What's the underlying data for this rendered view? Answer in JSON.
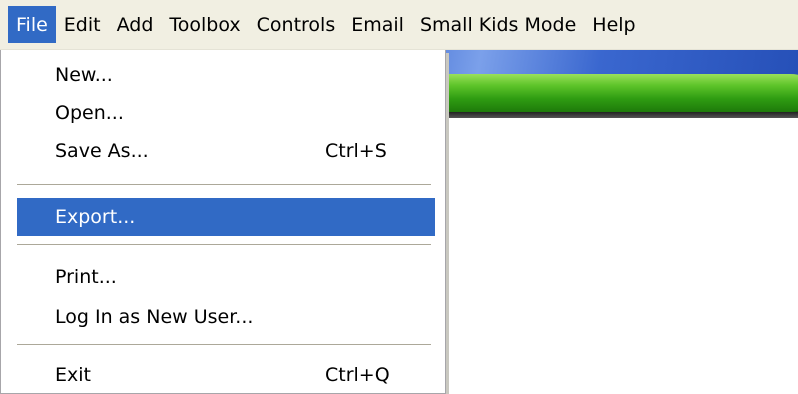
{
  "menubar": {
    "items": [
      {
        "label": "File",
        "active": true
      },
      {
        "label": "Edit"
      },
      {
        "label": "Add"
      },
      {
        "label": "Toolbox"
      },
      {
        "label": "Controls"
      },
      {
        "label": "Email"
      },
      {
        "label": "Small Kids Mode"
      },
      {
        "label": "Help"
      }
    ]
  },
  "file_menu": {
    "items": [
      {
        "label": "New...",
        "shortcut": ""
      },
      {
        "label": "Open...",
        "shortcut": ""
      },
      {
        "label": "Save As...",
        "shortcut": "Ctrl+S"
      },
      {
        "label": "Export...",
        "shortcut": "",
        "highlighted": true
      },
      {
        "label": "Print...",
        "shortcut": ""
      },
      {
        "label": "Log In as New User...",
        "shortcut": ""
      },
      {
        "label": "Exit",
        "shortcut": "Ctrl+Q"
      }
    ]
  },
  "colors": {
    "menubar_bg": "#f1efe2",
    "highlight": "#316ac5",
    "banner_green": "#2f9c12",
    "banner_blue": "#2b5bc8"
  }
}
